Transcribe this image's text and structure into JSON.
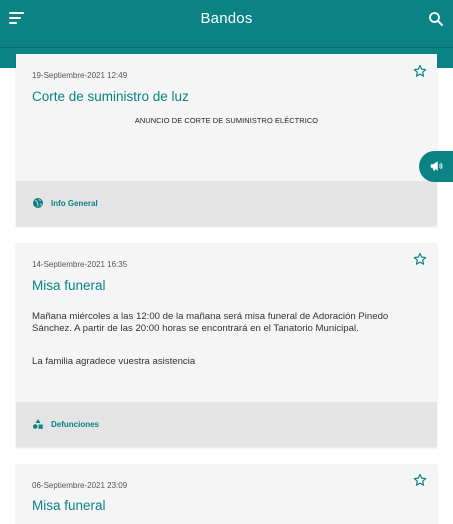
{
  "app": {
    "title": "Bandos"
  },
  "colors": {
    "brand": "#0b8384",
    "card": "#f5f5f5",
    "footer": "#e4e4e4"
  },
  "icons": {
    "menu": "menu-icon",
    "search": "search-icon",
    "favorite": "star-outline-icon",
    "announce": "megaphone-icon",
    "info_general": "globe-icon",
    "defunciones": "shapes-icon"
  },
  "posts": [
    {
      "date": "19-Septiembre-2021 12:49",
      "title": "Corte de suministro de luz",
      "subhead": "ANUNCIO DE CORTE DE SUMINISTRO ELÉCTRICO",
      "category": "Info General"
    },
    {
      "date": "14-Septiembre-2021 16:35",
      "title": "Misa funeral",
      "body_1": "Mañana miércoles a las 12:00 de la mañana será misa funeral de Adoración Pinedo Sánchez. A partir de las 20:00 horas se encontrará en el Tanatorio Municipal.",
      "body_2": "La familia agradece vuestra asistencia",
      "category": "Defunciones"
    },
    {
      "date": "06-Septiembre-2021 23:09",
      "title": "Misa funeral"
    }
  ]
}
